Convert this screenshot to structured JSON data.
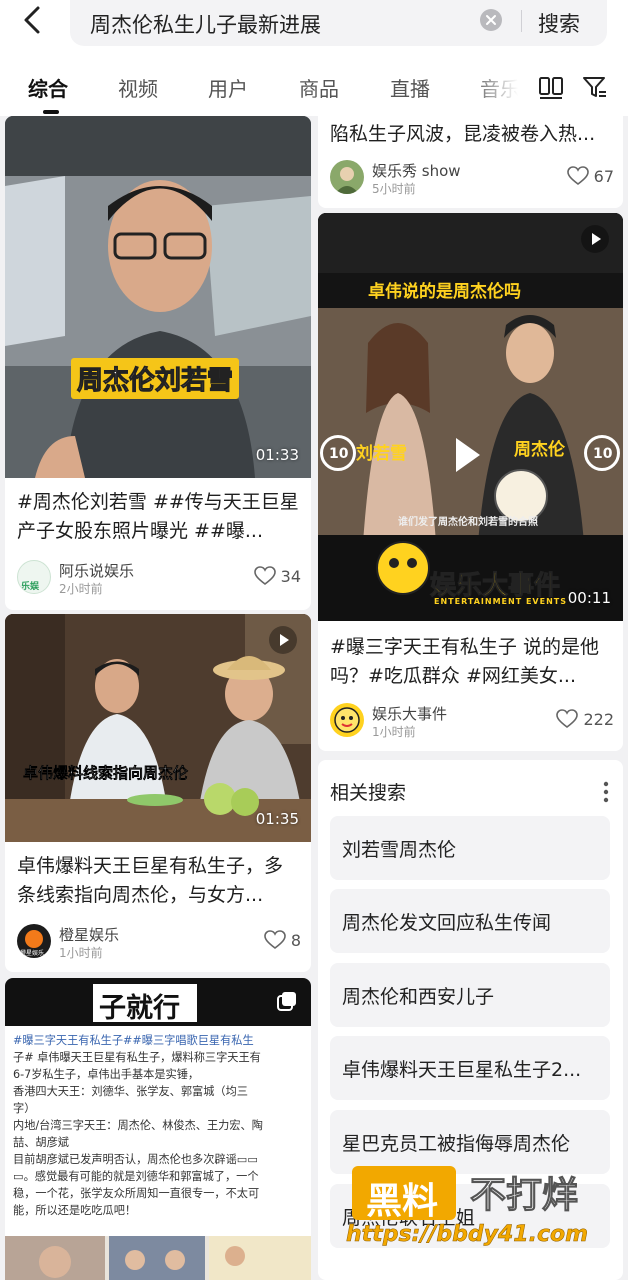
{
  "search": {
    "query": "周杰伦私生儿子最新进展",
    "button_label": "搜索"
  },
  "tabs": [
    {
      "label": "综合",
      "active": true
    },
    {
      "label": "视频",
      "active": false
    },
    {
      "label": "用户",
      "active": false
    },
    {
      "label": "商品",
      "active": false
    },
    {
      "label": "直播",
      "active": false
    },
    {
      "label": "音乐",
      "active": false
    }
  ],
  "toolbar_icons": [
    "layout-toggle-icon",
    "filter-icon"
  ],
  "cards": {
    "c1": {
      "overlay_caption": "周杰伦刘若雪",
      "duration": "01:33",
      "title": "#周杰伦刘若雪 ##传与天王巨星产子女股东照片曝光 ##曝...",
      "author": "阿乐说娱乐",
      "avatar_text": "乐娱",
      "time": "2小时前",
      "likes": "34"
    },
    "c2": {
      "title_tail": "陷私生子风波，昆凌被卷入热...",
      "author": "娱乐秀 show",
      "time": "5小时前",
      "likes": "67"
    },
    "c3": {
      "top_caption": "卓伟说的是周杰伦吗",
      "label_left": "刘若雪",
      "label_right": "周杰伦",
      "sub_caption": "谁们发了周杰伦和刘若雪的合照",
      "brand_big": "娱乐大事件",
      "brand_small": "ENTERTAINMENT EVENTS",
      "skip_back": "10",
      "skip_fwd": "10",
      "duration": "00:11",
      "title": "#曝三字天王有私生子 说的是他吗？#吃瓜群众 #网红美女...",
      "author": "娱乐大事件",
      "time": "1小时前",
      "likes": "222"
    },
    "c4": {
      "overlay_caption": "卓伟爆料线索指向周杰伦",
      "duration": "01:35",
      "title": "卓伟爆料天王巨星有私生子，多条线索指向周杰伦，与女方...",
      "author": "橙星娱乐",
      "avatar_text": "橙星娱乐",
      "time": "1小时前",
      "likes": "8"
    },
    "c5": {
      "header_text": "子就行",
      "body_lines": [
        "#曝三字天王有私生子##曝三字唱歌巨星有私生",
        "子# 卓伟曝天王巨星有私生子，爆料称三字天王有",
        "6-7岁私生子，卓伟出手基本是实锤，",
        "香港四大天王：刘德华、张学友、郭富城（均三",
        "字）",
        "内地/台湾三字天王：周杰伦、林俊杰、王力宏、陶",
        "喆、胡彦斌",
        "目前胡彦斌已发声明否认，周杰伦也多次辟谣▭▭",
        "▭。感觉最有可能的就是刘德华和郭富城了，一个",
        "稳，一个花，张学友众所周知一直很专一，不太可",
        "能，所以还是吃吃瓜吧！"
      ]
    }
  },
  "related": {
    "title": "相关搜索",
    "items": [
      "刘若雪周杰伦",
      "周杰伦发文回应私生传闻",
      "周杰伦和西安儿子",
      "卓伟爆料天王巨星私生子2...",
      "星巴克员工被指侮辱周杰伦",
      "周杰伦联名空姐"
    ]
  },
  "watermark": {
    "left": "黑料",
    "right": "不打烊",
    "url": "https://bbdy41.com"
  }
}
